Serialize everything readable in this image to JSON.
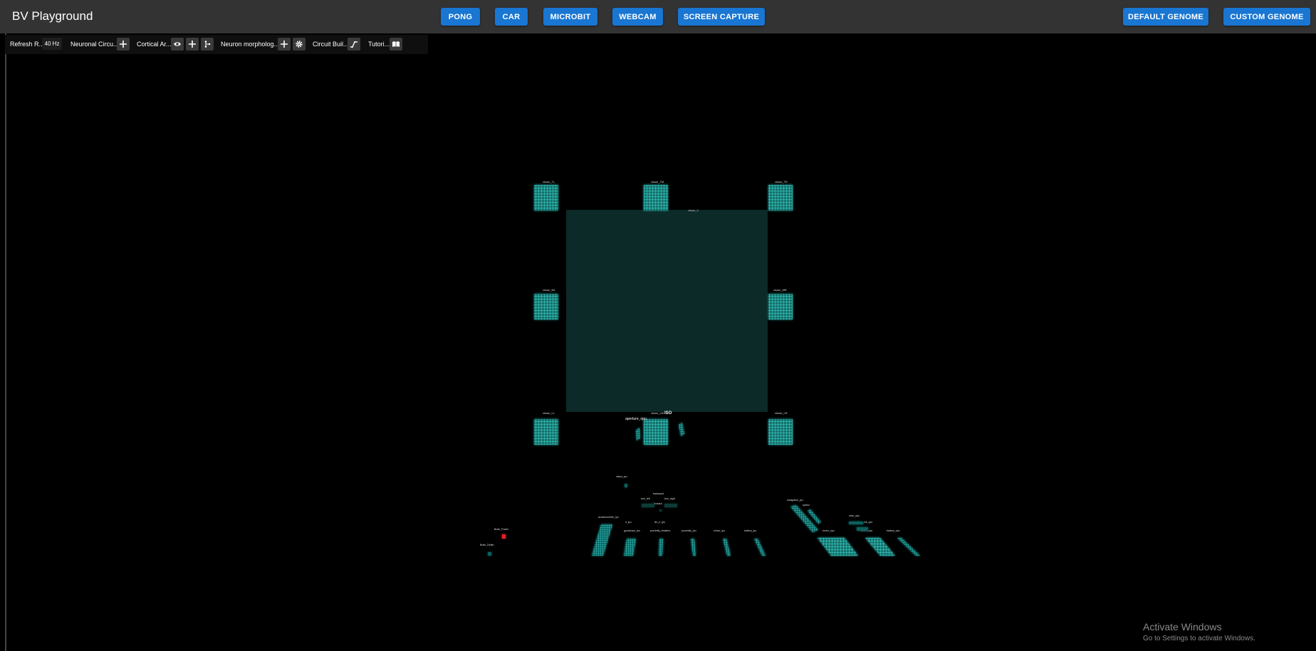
{
  "app": {
    "title": "BV Playground"
  },
  "nav": {
    "left_buttons": [
      "PONG",
      "CAR",
      "MICROBIT",
      "WEBCAM",
      "SCREEN CAPTURE"
    ],
    "right_buttons": [
      "DEFAULT GENOME",
      "CUSTOM GENOME"
    ]
  },
  "toolbar": {
    "refresh_label": "Refresh R...",
    "refresh_value": "40 Hz",
    "neuronal_label": "Neuronal Circu...",
    "cortical_label": "Cortical Ar...",
    "morphology_label": "Neuron morpholog...",
    "circuit_label": "Circuit Buil...",
    "tutorial_label": "Tutori..."
  },
  "brain": {
    "vision_areas": [
      "vision_TL",
      "vision_TM",
      "vision_TR",
      "vision_ML",
      "vision_MR",
      "vision_LL",
      "vision_LM",
      "vision_LR"
    ],
    "center_area": "vision_C",
    "aperture_label": "aperture_opu",
    "iso_label": "ISO",
    "small_labels": {
      "vision_ipu": "vision_ipu",
      "backward": "backward",
      "turn_left": "turn_left",
      "turn_right": "turn_right",
      "forward": "forward",
      "accelerometer_ipu": "accelerometer_ipu",
      "ir_ipu": "ir_ipu",
      "iim_ir_ipu": "iim_ir_ipu",
      "gyroscope_ipu": "gyroscope_ipu",
      "proximity_thalamu": "proximity_thalamu",
      "proximity_ipu": "proximity_ipu",
      "shock_ipu": "shock_ipu",
      "battery_ipu": "battery_ipu",
      "navigation_ipu": "navigation_ipu",
      "speed": "speed",
      "misc_opu": "misc_opu",
      "position_init_opu": "position_init_opu",
      "motor_opu": "motor_opu",
      "servo_opu": "servo_opu",
      "battery_opu": "battery_opu",
      "brain_power": "Brain_Power",
      "brain_death": "Brain_Death"
    }
  },
  "watermark": {
    "title": "Activate Windows",
    "subtitle": "Go to Settings to activate Windows."
  },
  "colors": {
    "accent": "#1976d2",
    "topbar": "#333333",
    "cortical": "#2ec4c0",
    "center_area": "#0b2a28",
    "brain_power": "#e02020"
  }
}
